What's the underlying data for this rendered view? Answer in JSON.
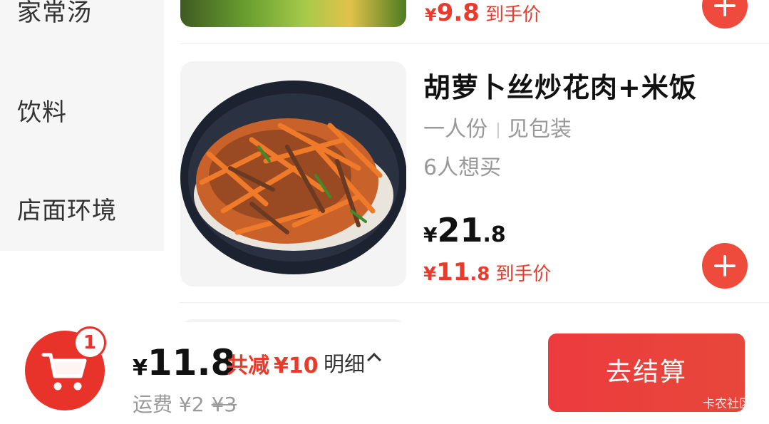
{
  "sidebar": {
    "categories": [
      "家常汤",
      "饮料",
      "店面环境"
    ]
  },
  "products": {
    "prev": {
      "deal_price_symbol": "¥",
      "deal_price": "9.8",
      "deal_suffix": "到手价"
    },
    "main": {
      "name": "胡萝卜丝炒花肉+米饭",
      "portion": "一人份",
      "package": "见包装",
      "want_count": "6人想买",
      "orig_symbol": "¥",
      "orig_int": "21",
      "orig_dec": ".8",
      "deal_symbol": "¥",
      "deal_int": "11",
      "deal_dec": ".8",
      "deal_suffix": "到手价"
    }
  },
  "cart": {
    "badge_count": "1",
    "total_symbol": "¥",
    "total": "11.8",
    "reduce_label": "共减",
    "reduce_amount": "¥10",
    "detail_label": "明细",
    "fee_label": "运费",
    "fee_current": "¥2",
    "fee_original": "¥3",
    "checkout_label": "去结算",
    "watermark": "卡农社区"
  },
  "colors": {
    "accent": "#e83b2c",
    "sidebar_bg": "#f6f6f6",
    "button": "#ee4b3c"
  },
  "icons": [
    "plus-icon",
    "cart-icon",
    "chevron-up-icon"
  ]
}
